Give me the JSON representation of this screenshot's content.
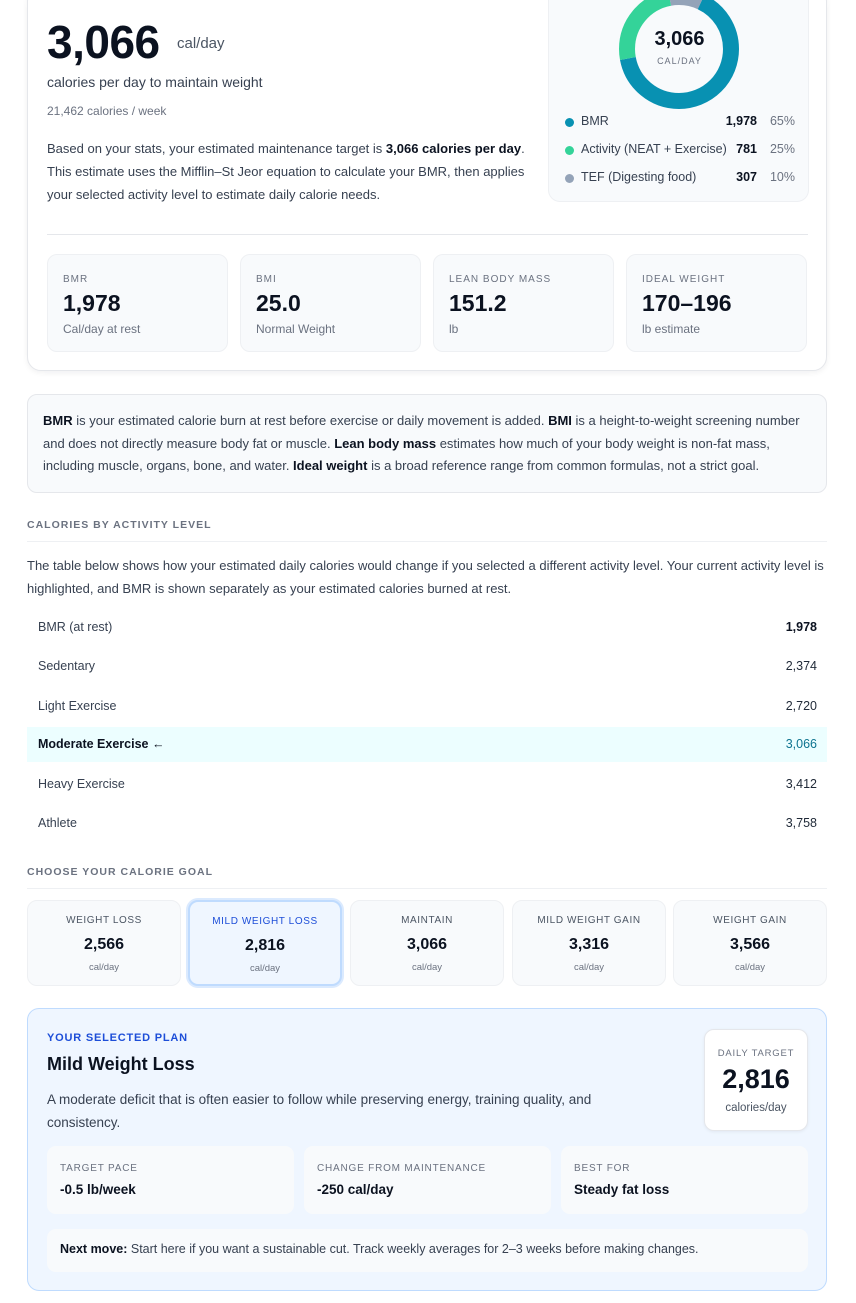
{
  "result": {
    "calories": "3,066",
    "unit": "cal/day",
    "subtitle": "calories per day to maintain weight",
    "weekly": "21,462 calories / week",
    "explain_pre": "Based on your stats, your estimated maintenance target is ",
    "explain_bold": "3,066 calories per day",
    "explain_post": ". This estimate uses the Mifflin–St Jeor equation to calculate your BMR, then applies your selected activity level to estimate daily calorie needs."
  },
  "donut": {
    "center_value": "3,066",
    "center_unit": "CAL/DAY",
    "segments": [
      {
        "label": "BMR",
        "value": "1,978",
        "pct": "65%",
        "fraction": 0.65,
        "color": "#0891b2"
      },
      {
        "label": "Activity (NEAT + Exercise)",
        "value": "781",
        "pct": "25%",
        "fraction": 0.25,
        "color": "#34d399"
      },
      {
        "label": "TEF (Digesting food)",
        "value": "307",
        "pct": "10%",
        "fraction": 0.1,
        "color": "#94a3b8"
      }
    ]
  },
  "stats": [
    {
      "label": "BMR",
      "value": "1,978",
      "sub": "Cal/day at rest"
    },
    {
      "label": "BMI",
      "value": "25.0",
      "sub": "Normal Weight"
    },
    {
      "label": "LEAN BODY MASS",
      "value": "151.2",
      "sub": "lb"
    },
    {
      "label": "IDEAL WEIGHT",
      "value": "170–196",
      "sub": "lb estimate"
    }
  ],
  "glossary": {
    "t1": "BMR",
    "d1": " is your estimated calorie burn at rest before exercise or daily movement is added. ",
    "t2": "BMI",
    "d2": " is a height-to-weight screening number and does not directly measure body fat or muscle. ",
    "t3": "Lean body mass",
    "d3": " estimates how much of your body weight is non-fat mass, including muscle, organs, bone, and water. ",
    "t4": "Ideal weight",
    "d4": " is a broad reference range from common formulas, not a strict goal."
  },
  "activity": {
    "title": "CALORIES BY ACTIVITY LEVEL",
    "intro": "The table below shows how your estimated daily calories would change if you selected a different activity level. Your current activity level is highlighted, and BMR is shown separately as your estimated calories burned at rest.",
    "rows": [
      {
        "label": "BMR (at rest)",
        "value": "1,978"
      },
      {
        "label": "Sedentary",
        "value": "2,374"
      },
      {
        "label": "Light Exercise",
        "value": "2,720"
      },
      {
        "label": "Moderate Exercise ←",
        "value": "3,066"
      },
      {
        "label": "Heavy Exercise",
        "value": "3,412"
      },
      {
        "label": "Athlete",
        "value": "3,758"
      }
    ]
  },
  "goals": {
    "title": "CHOOSE YOUR CALORIE GOAL",
    "items": [
      {
        "label": "WEIGHT LOSS",
        "value": "2,566",
        "unit": "cal/day"
      },
      {
        "label": "MILD WEIGHT LOSS",
        "value": "2,816",
        "unit": "cal/day"
      },
      {
        "label": "MAINTAIN",
        "value": "3,066",
        "unit": "cal/day"
      },
      {
        "label": "MILD WEIGHT GAIN",
        "value": "3,316",
        "unit": "cal/day"
      },
      {
        "label": "WEIGHT GAIN",
        "value": "3,566",
        "unit": "cal/day"
      }
    ]
  },
  "plan": {
    "kicker": "YOUR SELECTED PLAN",
    "title": "Mild Weight Loss",
    "desc": "A moderate deficit that is often easier to follow while preserving energy, training quality, and consistency.",
    "target_label": "DAILY TARGET",
    "target_value": "2,816",
    "target_unit": "calories/day",
    "metrics": [
      {
        "label": "TARGET PACE",
        "value": "-0.5 lb/week"
      },
      {
        "label": "CHANGE FROM MAINTENANCE",
        "value": "-250 cal/day"
      },
      {
        "label": "BEST FOR",
        "value": "Steady fat loss"
      }
    ],
    "next_label": "Next move:",
    "next_text": " Start here if you want a sustainable cut. Track weekly averages for 2–3 weeks before making changes."
  }
}
